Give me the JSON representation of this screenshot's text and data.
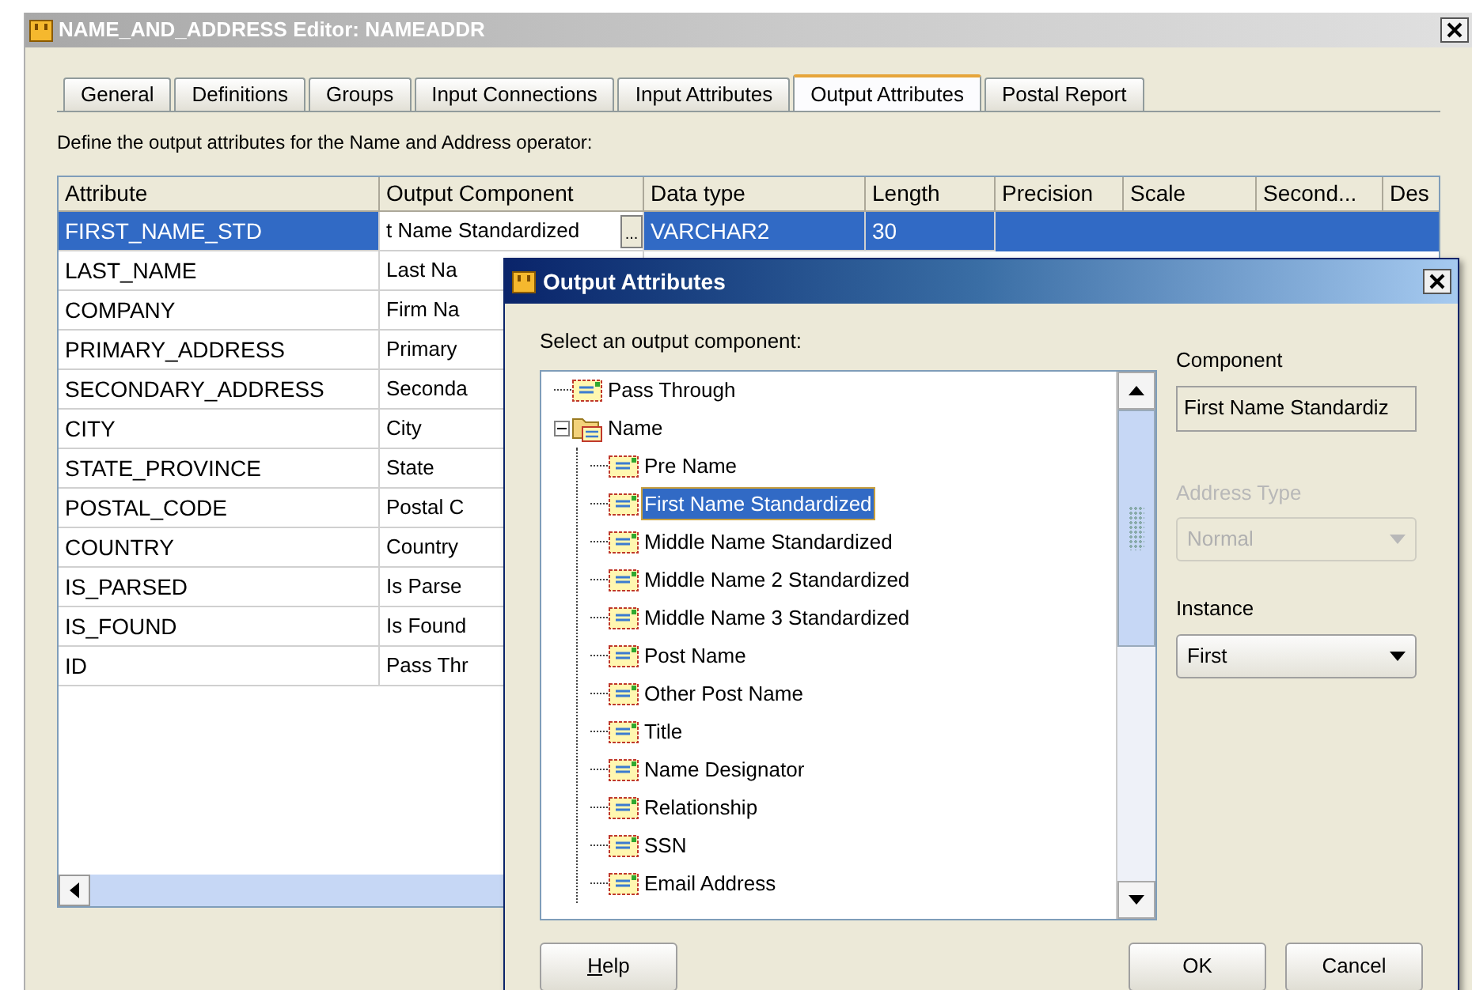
{
  "window": {
    "title": "NAME_AND_ADDRESS Editor: NAMEADDR"
  },
  "tabs": [
    {
      "label": "General",
      "selected": false
    },
    {
      "label": "Definitions",
      "selected": false
    },
    {
      "label": "Groups",
      "selected": false
    },
    {
      "label": "Input Connections",
      "selected": false
    },
    {
      "label": "Input Attributes",
      "selected": false
    },
    {
      "label": "Output Attributes",
      "selected": true
    },
    {
      "label": "Postal Report",
      "selected": false
    }
  ],
  "instructions": "Define the output attributes for the Name and Address operator:",
  "table": {
    "columns": [
      "Attribute",
      "Output Component",
      "Data type",
      "Length",
      "Precision",
      "Scale",
      "Second...",
      "Des"
    ],
    "rows": [
      {
        "attribute": "FIRST_NAME_STD",
        "output_component": "t Name Standardized",
        "browse_button": "...",
        "data_type": "VARCHAR2",
        "length": "30",
        "selected": true
      },
      {
        "attribute": "LAST_NAME",
        "output_component": "Last Na",
        "selected": false
      },
      {
        "attribute": "COMPANY",
        "output_component": "Firm Na",
        "selected": false
      },
      {
        "attribute": "PRIMARY_ADDRESS",
        "output_component": "Primary",
        "selected": false
      },
      {
        "attribute": "SECONDARY_ADDRESS",
        "output_component": "Seconda",
        "selected": false
      },
      {
        "attribute": "CITY",
        "output_component": "City",
        "selected": false
      },
      {
        "attribute": "STATE_PROVINCE",
        "output_component": "State",
        "selected": false
      },
      {
        "attribute": "POSTAL_CODE",
        "output_component": "Postal C",
        "selected": false
      },
      {
        "attribute": "COUNTRY",
        "output_component": "Country",
        "selected": false
      },
      {
        "attribute": "IS_PARSED",
        "output_component": "Is Parse",
        "selected": false
      },
      {
        "attribute": "IS_FOUND",
        "output_component": "Is Found",
        "selected": false
      },
      {
        "attribute": "ID",
        "output_component": "Pass Thr",
        "selected": false
      }
    ]
  },
  "dialog": {
    "title": "Output Attributes",
    "prompt": "Select an output component:",
    "tree": [
      {
        "label": "Pass Through",
        "selected": false
      },
      {
        "label": "Name",
        "selected": false,
        "expanded": true,
        "children": [
          {
            "label": "Pre Name",
            "selected": false
          },
          {
            "label": "First Name Standardized",
            "selected": true
          },
          {
            "label": "Middle Name Standardized",
            "selected": false
          },
          {
            "label": "Middle Name 2 Standardized",
            "selected": false
          },
          {
            "label": "Middle Name 3 Standardized",
            "selected": false
          },
          {
            "label": "Post Name",
            "selected": false
          },
          {
            "label": "Other Post Name",
            "selected": false
          },
          {
            "label": "Title",
            "selected": false
          },
          {
            "label": "Name Designator",
            "selected": false
          },
          {
            "label": "Relationship",
            "selected": false
          },
          {
            "label": "SSN",
            "selected": false
          },
          {
            "label": "Email Address",
            "selected": false
          }
        ]
      }
    ],
    "component": {
      "label": "Component",
      "value": "First Name Standardiz"
    },
    "address_type": {
      "label": "Address Type",
      "value": "Normal",
      "disabled": true
    },
    "instance": {
      "label": "Instance",
      "value": "First",
      "disabled": false
    },
    "buttons": [
      {
        "label": "Help",
        "mnemonic": true
      },
      {
        "label": "OK",
        "mnemonic": false
      },
      {
        "label": "Cancel",
        "mnemonic": false
      }
    ]
  }
}
